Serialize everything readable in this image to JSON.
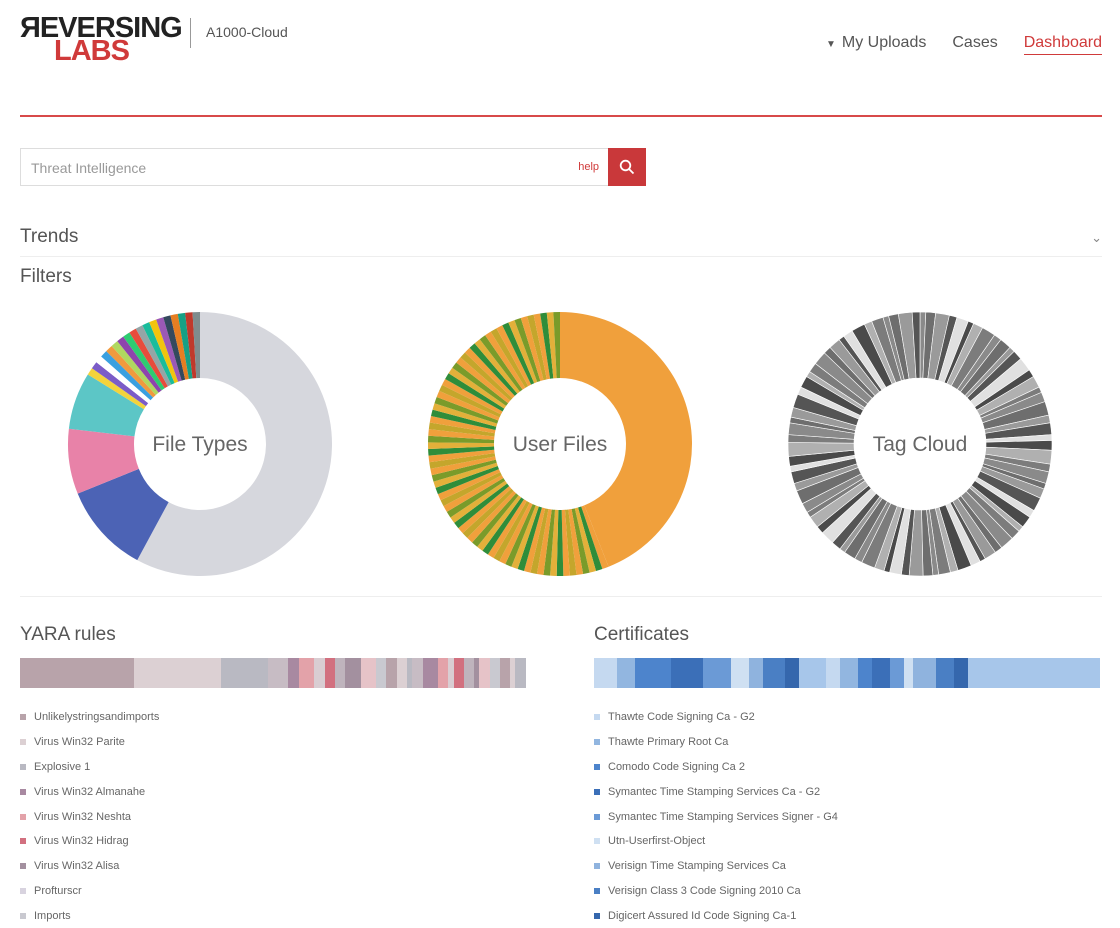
{
  "brand": {
    "logo_top": "ЯEVERSING",
    "logo_bottom": "LABS",
    "product": "A1000-Cloud"
  },
  "nav": {
    "uploads": "My Uploads",
    "cases": "Cases",
    "dashboard": "Dashboard"
  },
  "search": {
    "placeholder": "Threat Intelligence",
    "help": "help"
  },
  "trends": {
    "label": "Trends"
  },
  "filters": {
    "label": "Filters",
    "charts": [
      {
        "label": "File Types"
      },
      {
        "label": "User Files"
      },
      {
        "label": "Tag Cloud"
      }
    ]
  },
  "colors": {
    "brand_red": "#c9383a",
    "accent_line": "#d84a4a"
  },
  "yara": {
    "title": "YARA rules",
    "items": [
      {
        "label": "Unlikelystringsandimports",
        "color": "#b8a3aa"
      },
      {
        "label": "Virus Win32 Parite",
        "color": "#dcd0d3"
      },
      {
        "label": "Explosive 1",
        "color": "#b9b9c2"
      },
      {
        "label": "Virus Win32 Almanahe",
        "color": "#a889a1"
      },
      {
        "label": "Virus Win32 Neshta",
        "color": "#e3a2a9"
      },
      {
        "label": "Virus Win32 Hidrag",
        "color": "#d2707f"
      },
      {
        "label": "Virus Win32 Alisa",
        "color": "#a3909f"
      },
      {
        "label": "Profturscr",
        "color": "#d8d3df"
      },
      {
        "label": "Imports",
        "color": "#c9c9d0"
      }
    ]
  },
  "certificates": {
    "title": "Certificates",
    "items": [
      {
        "label": "Thawte Code Signing Ca - G2",
        "color": "#c5d9f0"
      },
      {
        "label": "Thawte Primary Root Ca",
        "color": "#92b6e0"
      },
      {
        "label": "Comodo Code Signing Ca 2",
        "color": "#4d84cc"
      },
      {
        "label": "Symantec Time Stamping Services Ca - G2",
        "color": "#3b6fb8"
      },
      {
        "label": "Symantec Time Stamping Services Signer - G4",
        "color": "#6b9ad6"
      },
      {
        "label": "Utn-Userfirst-Object",
        "color": "#cfe0f2"
      },
      {
        "label": "Verisign Time Stamping Services Ca",
        "color": "#8fb3de"
      },
      {
        "label": "Verisign Class 3 Code Signing 2010 Ca",
        "color": "#4a7fc4"
      },
      {
        "label": "Digicert Assured Id Code Signing Ca-1",
        "color": "#3567ad"
      }
    ]
  }
}
